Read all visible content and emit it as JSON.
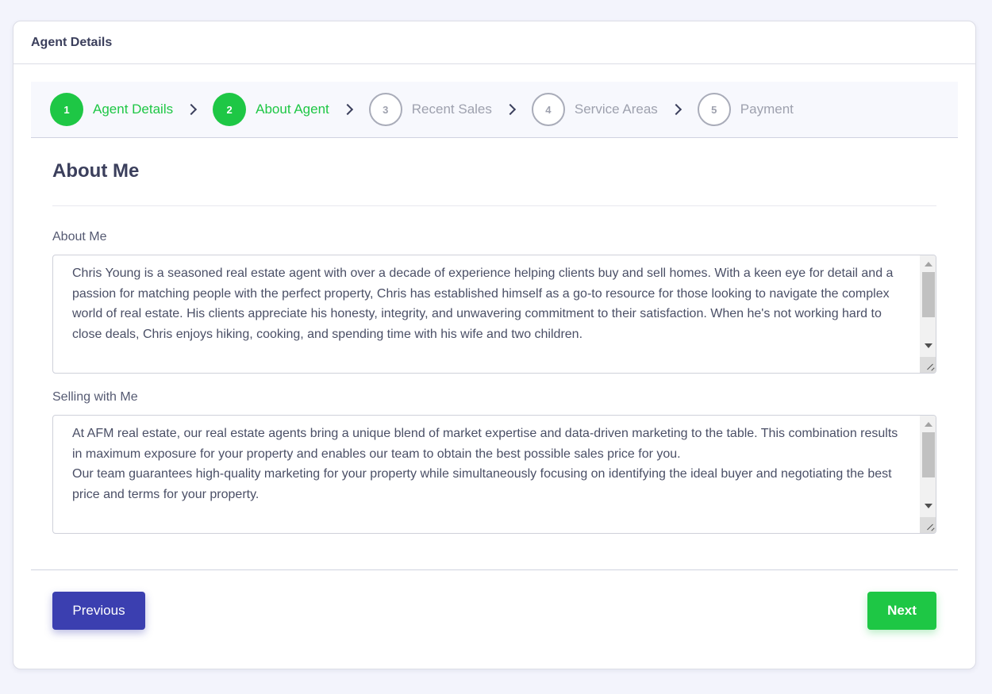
{
  "card": {
    "title": "Agent Details"
  },
  "stepper": {
    "steps": [
      {
        "number": "1",
        "label": "Agent Details",
        "state": "done"
      },
      {
        "number": "2",
        "label": "About Agent",
        "state": "done"
      },
      {
        "number": "3",
        "label": "Recent Sales",
        "state": "todo"
      },
      {
        "number": "4",
        "label": "Service Areas",
        "state": "todo"
      },
      {
        "number": "5",
        "label": "Payment",
        "state": "todo"
      }
    ]
  },
  "section": {
    "title": "About Me"
  },
  "fields": {
    "about_me": {
      "label": "About Me",
      "value": "Chris Young is a seasoned real estate agent with over a decade of experience helping clients buy and sell homes. With a keen eye for detail and a passion for matching people with the perfect property, Chris has established himself as a go-to resource for those looking to navigate the complex world of real estate. His clients appreciate his honesty, integrity, and unwavering commitment to their satisfaction. When he's not working hard to close deals, Chris enjoys hiking, cooking, and spending time with his wife and two children."
    },
    "selling_with_me": {
      "label": "Selling with Me",
      "value": "At AFM real estate, our real estate agents bring a unique blend of market expertise and data-driven marketing to the table. This combination results in maximum exposure for your property and enables our team to obtain the best possible sales price for you.\nOur team guarantees high-quality marketing for your property while simultaneously focusing on identifying the ideal buyer and negotiating the best price and terms for your property."
    }
  },
  "buttons": {
    "previous": "Previous",
    "next": "Next"
  },
  "colors": {
    "accent_green": "#1ec745",
    "primary_blue": "#3b3fb0",
    "muted": "#9ea1ae"
  },
  "icons": {
    "step_separator": "chevron-right-icon"
  }
}
